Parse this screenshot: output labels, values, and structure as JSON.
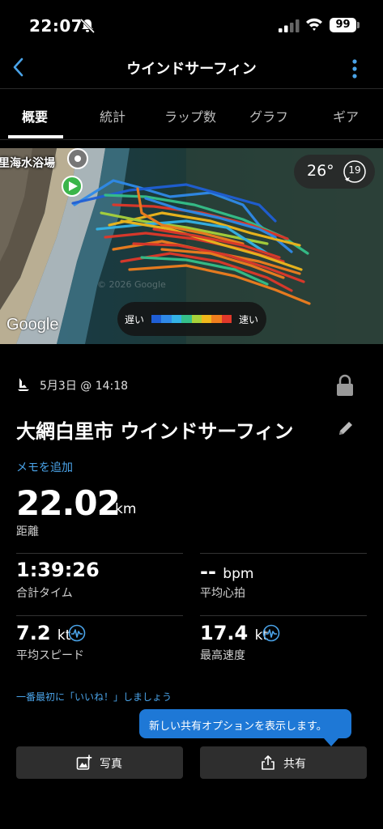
{
  "status_bar": {
    "time": "22:07",
    "battery": "99"
  },
  "nav": {
    "title": "ウインドサーフィン"
  },
  "tabs": [
    {
      "label": "概要",
      "active": true
    },
    {
      "label": "統計",
      "active": false
    },
    {
      "label": "ラップ数",
      "active": false
    },
    {
      "label": "グラフ",
      "active": false
    },
    {
      "label": "ギア",
      "active": false
    }
  ],
  "map": {
    "place_label": "里海水浴場",
    "temperature": "26°",
    "wind_speed": "19",
    "legend_slow": "遅い",
    "legend_fast": "速い",
    "provider": "Google",
    "watermark": "© 2026 Google",
    "legend_colors": [
      "#1f5fd6",
      "#2f8ae8",
      "#34b3e6",
      "#35c08a",
      "#a8d23a",
      "#f0b81c",
      "#f07e1e",
      "#e0382a"
    ]
  },
  "activity": {
    "date": "5月3日 @ 14:18",
    "title": "大網白里市 ウインドサーフィン",
    "add_memo": "メモを追加"
  },
  "distance": {
    "value": "22.02",
    "unit": "km",
    "label": "距離"
  },
  "stats": {
    "total_time": {
      "value": "1:39:26",
      "label": "合計タイム"
    },
    "avg_hr": {
      "value": "--",
      "unit": "bpm",
      "label": "平均心拍"
    },
    "avg_speed": {
      "value": "7.2",
      "unit": "kt",
      "label": "平均スピード"
    },
    "max_speed": {
      "value": "17.4",
      "unit": "kt",
      "label": "最高速度"
    }
  },
  "like_text": "一番最初に「いいね！」しましょう",
  "tooltip": "新しい共有オプションを表示します。",
  "buttons": {
    "photo": "写真",
    "share": "共有"
  }
}
